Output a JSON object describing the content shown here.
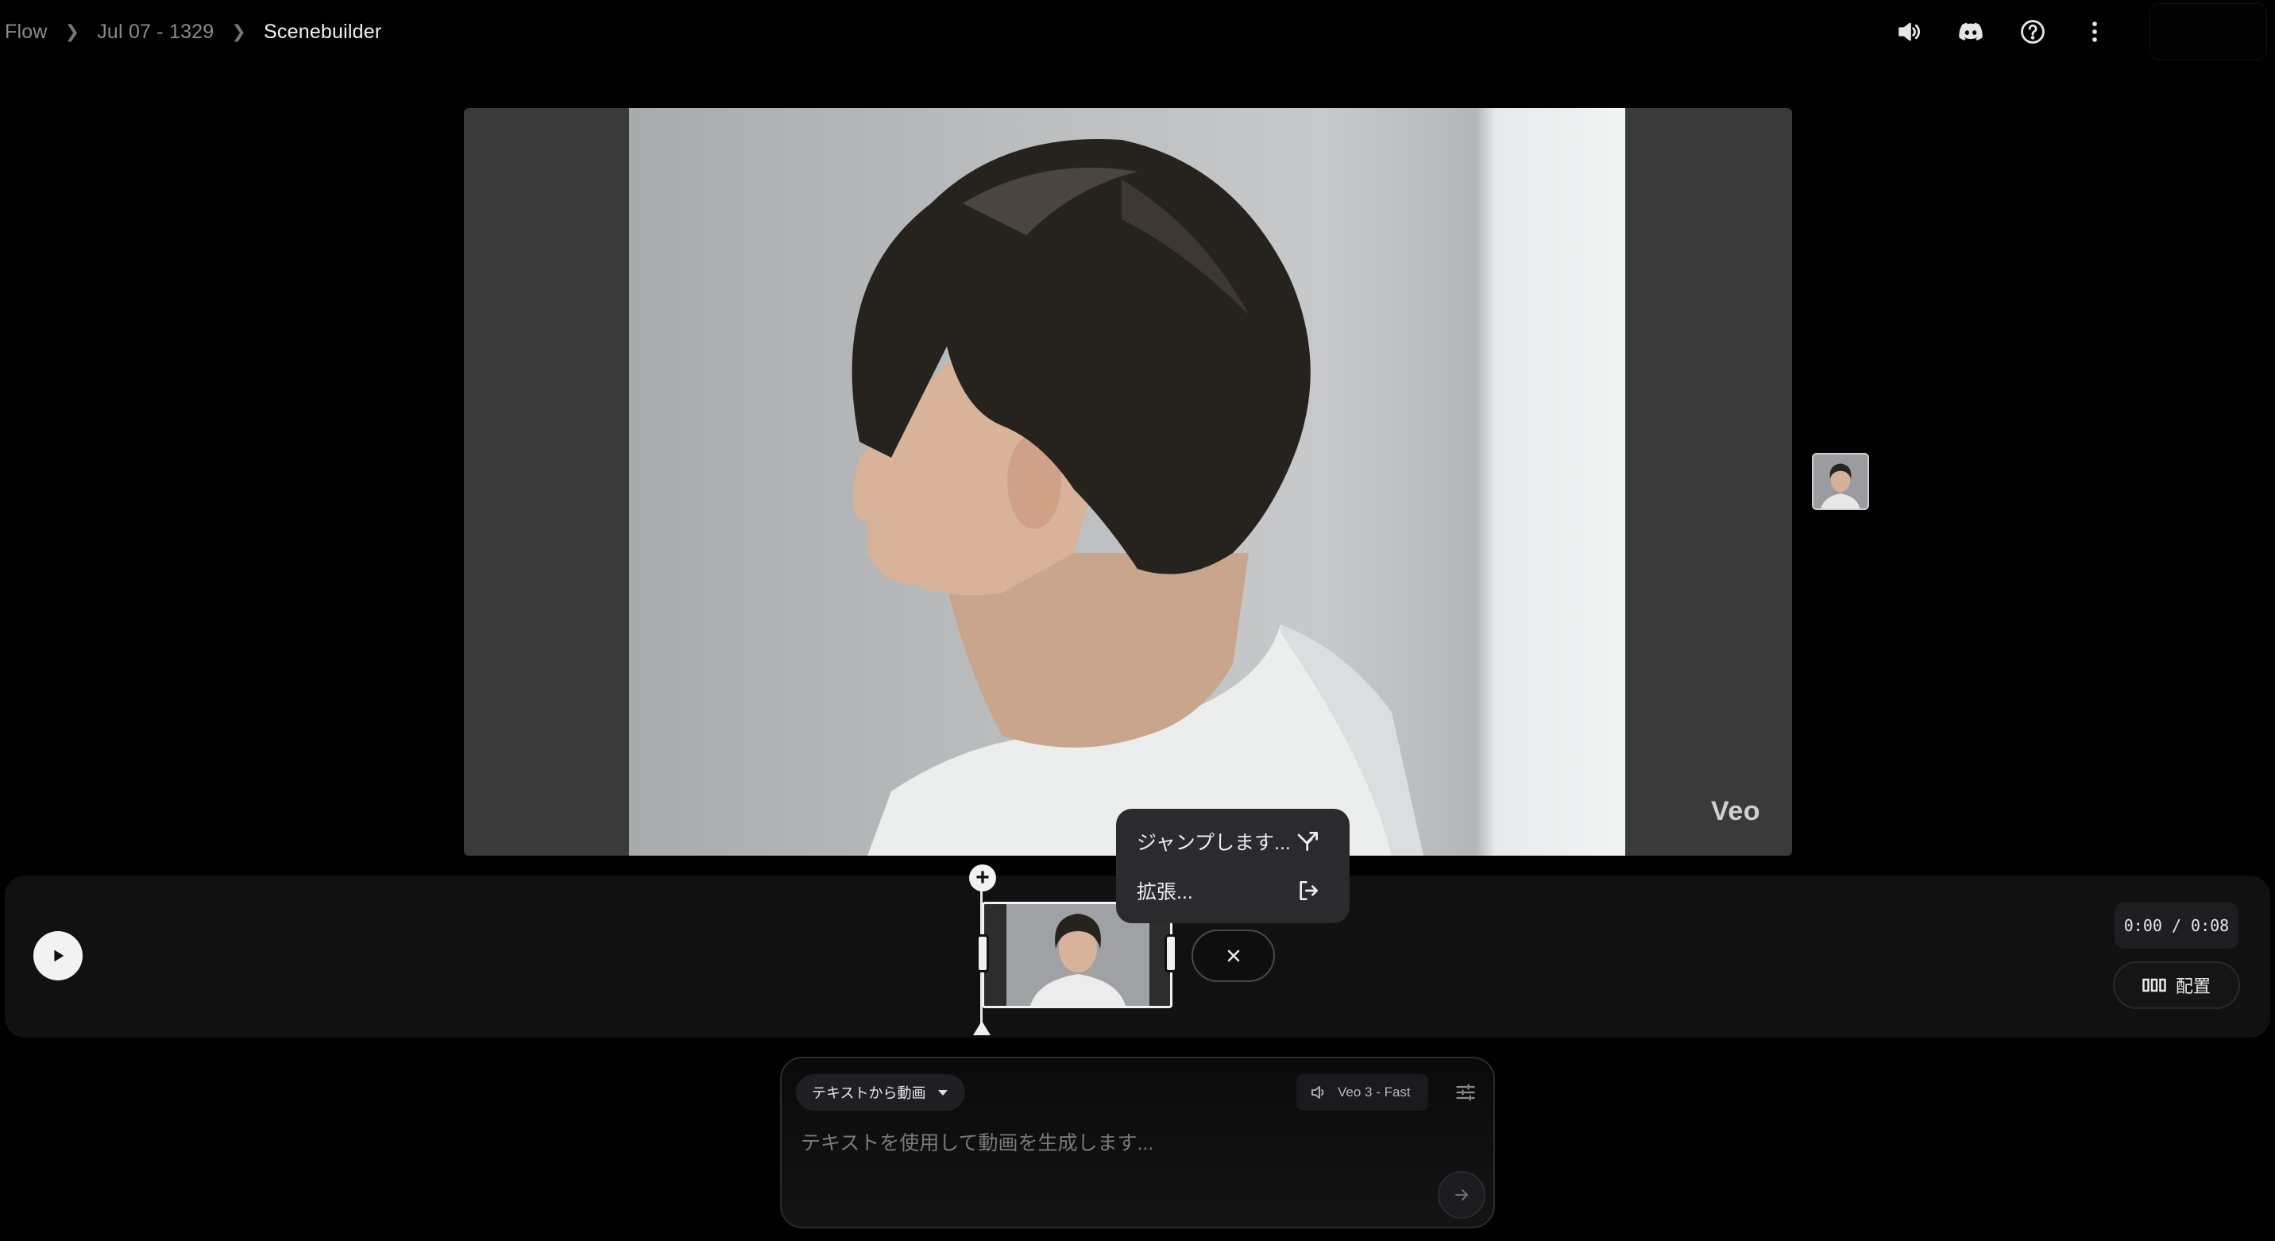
{
  "breadcrumb": {
    "items": [
      "Flow",
      "Jul 07 - 1329",
      "Scenebuilder"
    ]
  },
  "header": {
    "icons": [
      "volume-icon",
      "discord-icon",
      "help-icon",
      "more-vert-icon"
    ]
  },
  "preview": {
    "watermark": "Veo"
  },
  "popup_menu": {
    "items": [
      {
        "label": "ジャンプします...",
        "icon": "jump-icon"
      },
      {
        "label": "拡張...",
        "icon": "extend-icon"
      }
    ]
  },
  "timeline": {
    "time_display": "0:00 / 0:08",
    "arrange_label": "配置",
    "add_clip_label": "+"
  },
  "prompt": {
    "mode_label": "テキストから動画",
    "model_label": "Veo 3 - Fast",
    "placeholder": "テキストを使用して動画を生成します..."
  },
  "colors": {
    "background": "#000000",
    "panel": "#111112",
    "popup": "#2b2b2d",
    "text_primary": "#f2f2f2",
    "text_muted": "#8a8a8a"
  }
}
